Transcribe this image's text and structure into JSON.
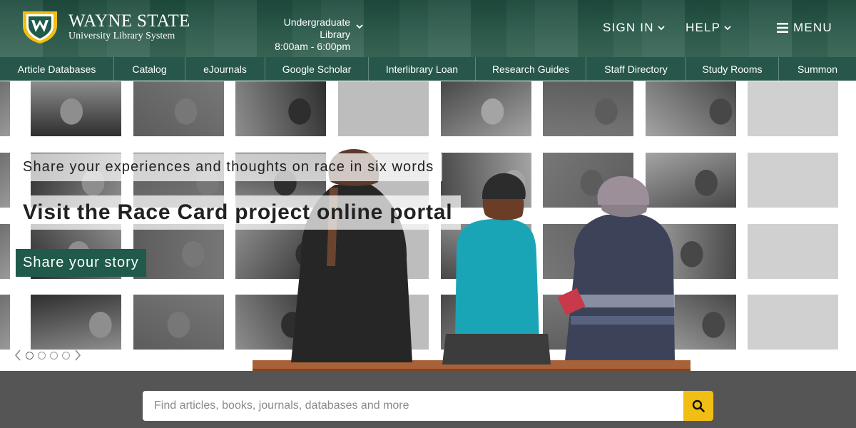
{
  "header": {
    "logo_name": "WAYNE STATE",
    "logo_sub": "University Library System",
    "library_name": "Undergraduate Library",
    "library_hours": "8:00am - 6:00pm",
    "sign_in": "SIGN IN",
    "help": "HELP",
    "menu": "MENU"
  },
  "nav": {
    "items": [
      {
        "label": "Article Databases"
      },
      {
        "label": "Catalog"
      },
      {
        "label": "eJournals"
      },
      {
        "label": "Google Scholar"
      },
      {
        "label": "Interlibrary Loan"
      },
      {
        "label": "Research Guides"
      },
      {
        "label": "Staff Directory"
      },
      {
        "label": "Study Rooms"
      },
      {
        "label": "Summon"
      }
    ]
  },
  "hero": {
    "tagline": "Share your experiences and thoughts on race in six words",
    "headline": "Visit the Race Card project online portal",
    "cta": "Share your story",
    "slides": 4,
    "active_slide": 1
  },
  "search": {
    "placeholder": "Find articles, books, journals, databases and more"
  },
  "colors": {
    "brand_green": "#27574a",
    "button_green": "#1f5a4a",
    "accent_gold": "#f1bf13"
  },
  "icons": {
    "logo": "wayne-state-shield-icon",
    "hours_dropdown": "chevron-down-icon",
    "menu": "hamburger-icon",
    "search": "search-icon",
    "prev": "chevron-left-icon",
    "next": "chevron-right-icon"
  }
}
